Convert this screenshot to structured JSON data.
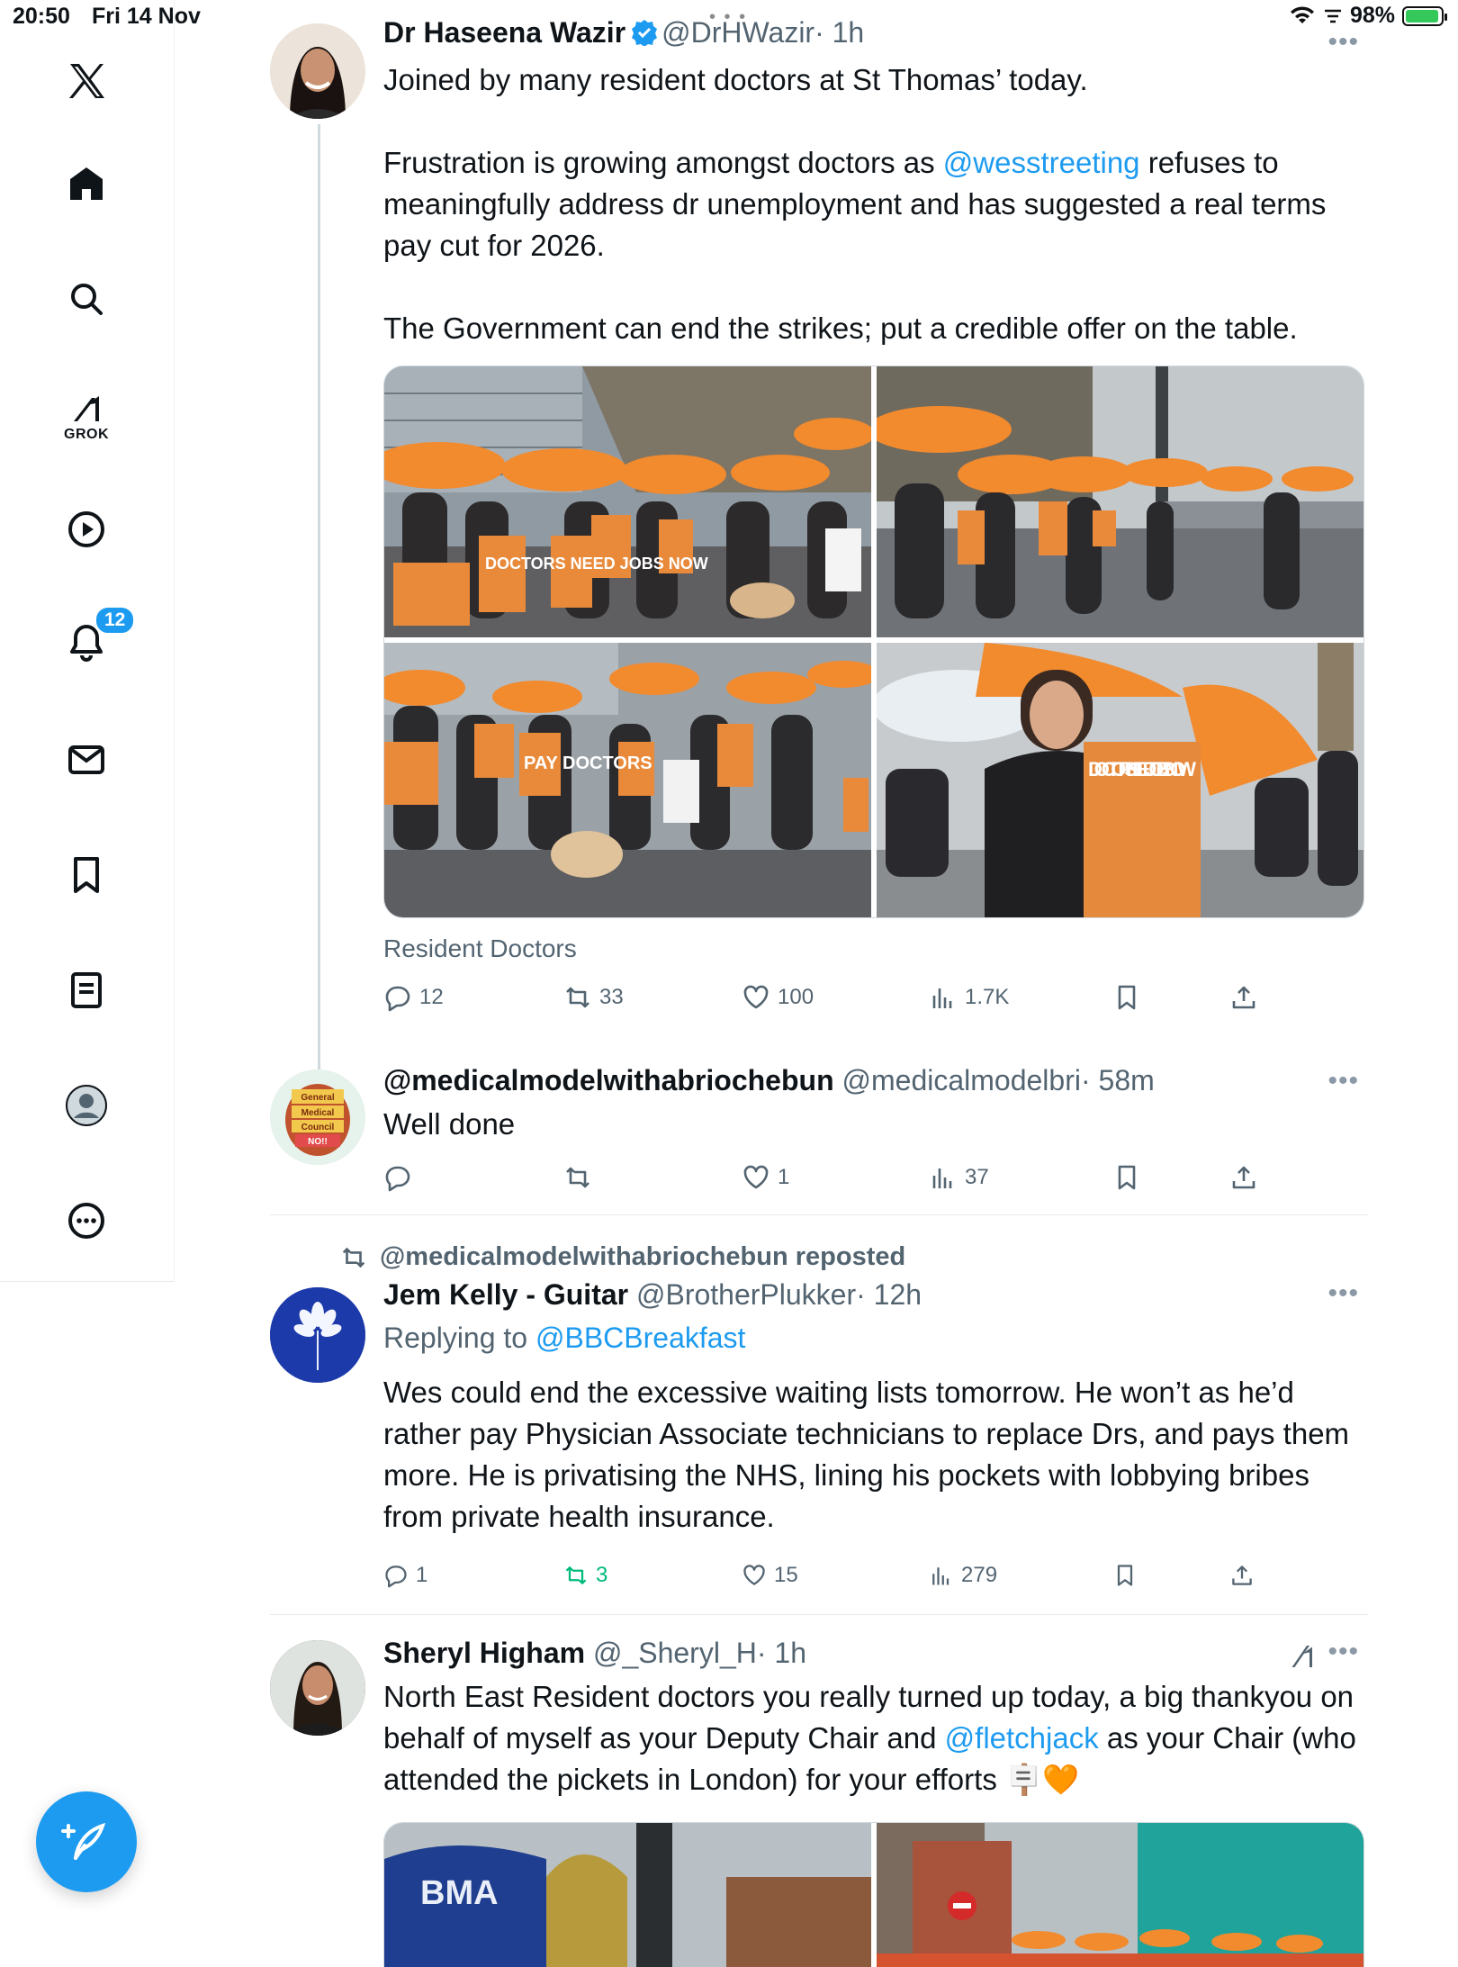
{
  "status_bar": {
    "time": "20:50",
    "date": "Fri 14 Nov",
    "battery": "98%"
  },
  "sidebar": {
    "items": [
      {
        "name": "x-logo-icon"
      },
      {
        "name": "home-icon"
      },
      {
        "name": "search-icon"
      },
      {
        "name": "grok-icon",
        "label": "GROK"
      },
      {
        "name": "video-icon"
      },
      {
        "name": "notifications-icon",
        "badge": "12"
      },
      {
        "name": "messages-icon"
      },
      {
        "name": "bookmarks-icon"
      },
      {
        "name": "lists-icon"
      },
      {
        "name": "profile-icon"
      },
      {
        "name": "more-icon"
      }
    ]
  },
  "tweets": [
    {
      "name": "Dr Haseena Wazir",
      "handle": "@DrHWazir",
      "time": "· 1h",
      "text_1": "Joined by many resident doctors at St Thomas’ today.",
      "text_2_pre": "Frustration is growing amongst doctors as ",
      "text_2_link": "@wesstreeting",
      "text_2_post": " refuses to meaningfully address dr unemployment and has suggested a real terms pay cut for 2026.",
      "text_3": "The Government can end the strikes; put a credible offer on the table.",
      "caption": "Resident Doctors",
      "photo_signs": [
        "DOCTORS NEED JOBS NOW",
        "PAY DOCTORS",
        "DOCTORS NEED JOBS NOW"
      ],
      "stats": {
        "replies": "12",
        "reposts": "33",
        "likes": "100",
        "views": "1.7K"
      }
    },
    {
      "name": "@medicalmodelwithabriochebun",
      "handle": "@medicalmodelbri",
      "time": "· 58m",
      "text": "Well done",
      "avatar_text": [
        "General",
        "Medical",
        "Council",
        "NO!!"
      ],
      "stats": {
        "replies": "",
        "reposts": "",
        "likes": "1",
        "views": "37"
      }
    },
    {
      "repost_label": "@medicalmodelwithabriochebun reposted",
      "name": "Jem Kelly - Guitar",
      "handle": "@BrotherPlukker",
      "time": "· 12h",
      "replying_to_label": "Replying to ",
      "replying_to": "@BBCBreakfast",
      "text": "Wes could end the excessive waiting lists tomorrow. He won’t as he’d rather pay Physician Associate technicians to replace Drs, and pays them more. He is privatising the NHS, lining his pockets with lobbying bribes from private health insurance.",
      "stats": {
        "replies": "1",
        "reposts": "3",
        "likes": "15",
        "views": "279"
      }
    },
    {
      "name": "Sheryl Higham",
      "handle": "@_Sheryl_H",
      "time": "· 1h",
      "text_pre": "North East Resident doctors you really turned up today, a big thankyou on behalf of myself as your Deputy Chair and ",
      "text_link": "@fletchjack",
      "text_post": " as your Chair (who attended the pickets in London) for your efforts ",
      "emoji": "🪧🧡",
      "photo_text": "BMA"
    }
  ],
  "colors": {
    "accent": "#1d9bf0",
    "repost_green": "#00ba7c",
    "muted": "#536471",
    "umbrella_orange": "#f28a2e"
  }
}
